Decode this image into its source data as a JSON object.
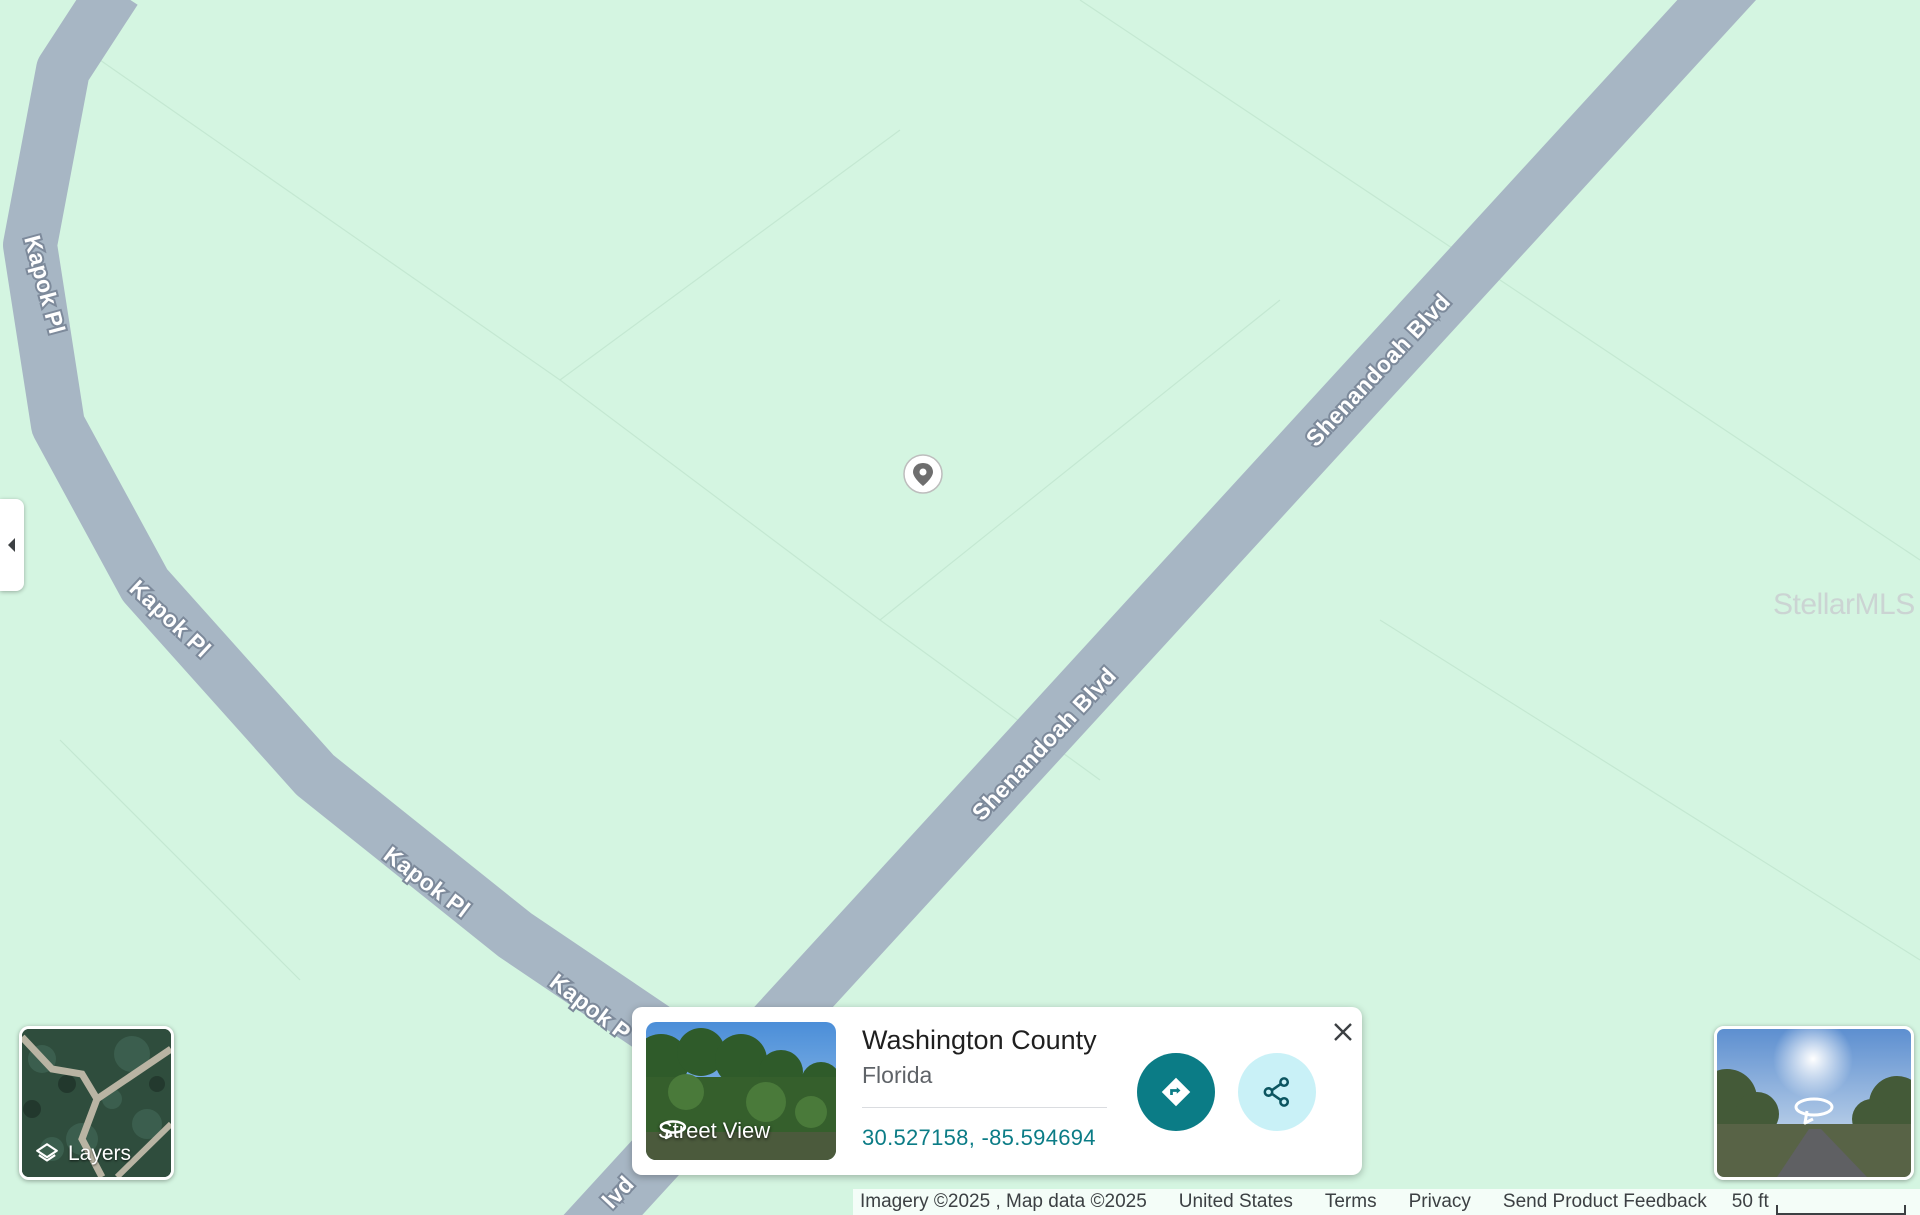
{
  "map": {
    "background_color": "#d4f5e1",
    "road_color": "#a7b6c4",
    "road_labels": {
      "kapok_1": "Kapok Pl",
      "kapok_2": "Kapok Pl",
      "kapok_3": "Kapok Pl",
      "kapok_4": "Kapok P",
      "shenandoah_1": "Shenandoah Blvd",
      "shenandoah_2": "Shenandoah Blvd",
      "shenandoah_3": "lvd"
    },
    "pin_icon": "map-pin-icon",
    "watermark": "StellarMLS"
  },
  "side_panel_toggle": {
    "icon": "caret-left-icon"
  },
  "layers": {
    "label": "Layers",
    "icon": "layers-icon"
  },
  "place_card": {
    "street_view_label": "Street View",
    "title": "Washington County",
    "subtitle": "Florida",
    "coordinates": "30.527158, -85.594694",
    "directions_icon": "directions-icon",
    "share_icon": "share-icon",
    "close_icon": "close-icon",
    "accent_color": "#0b7c86",
    "share_bg_color": "#c9f1f7"
  },
  "attribution": {
    "imagery": "Imagery ©2025 , Map data ©2025",
    "region": "United States",
    "terms": "Terms",
    "privacy": "Privacy",
    "feedback": "Send Product Feedback",
    "scale": "50 ft"
  }
}
